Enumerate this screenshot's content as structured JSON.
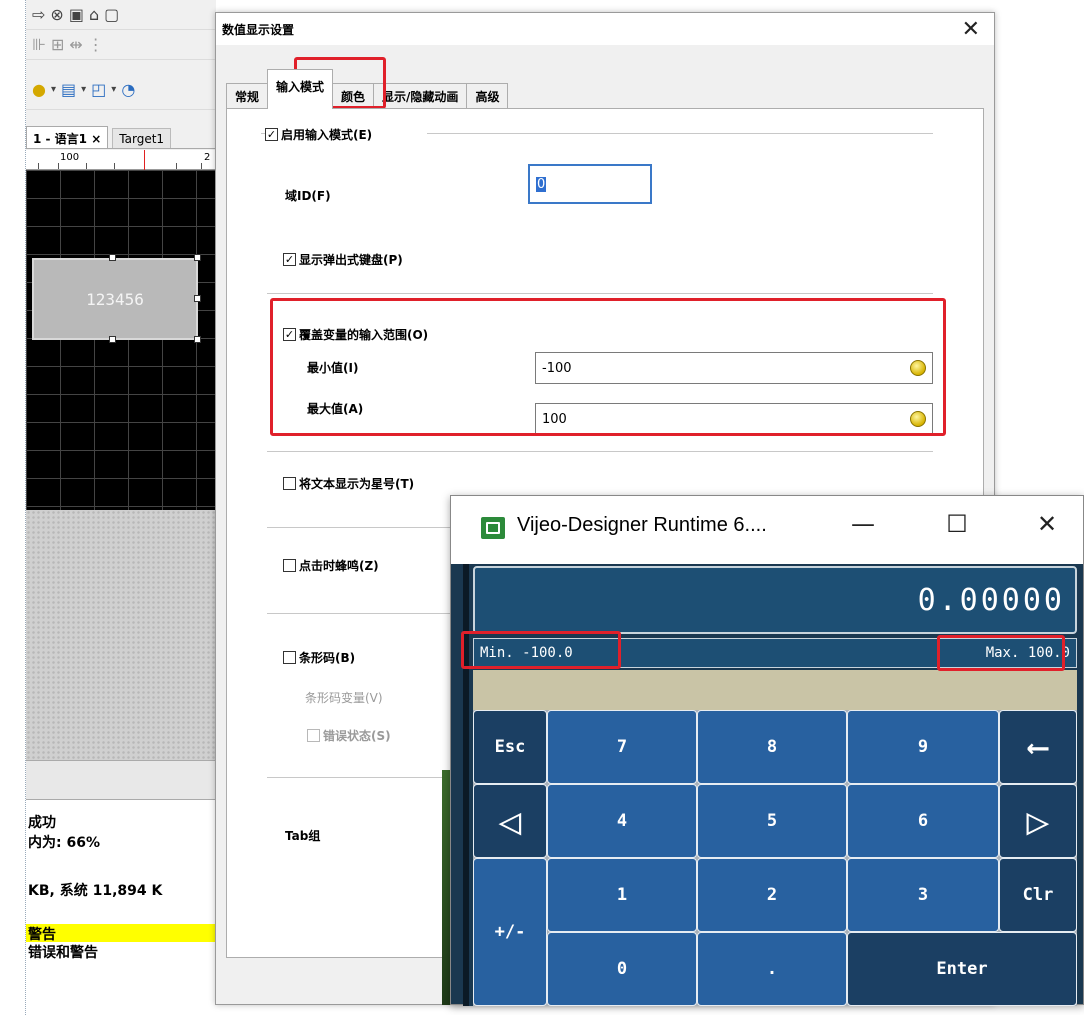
{
  "designer": {
    "tabs": [
      "1 - 语言1  ×",
      "Target1"
    ],
    "ruler_label": "100",
    "ruler_label2": "2",
    "widget_value": "123456",
    "log_lines": [
      "成功",
      "内为:  66%",
      " KB,  系统 11,894 K",
      "警告",
      "错误和警告"
    ]
  },
  "dialog": {
    "title": "数值显示设置",
    "tabs": [
      "常规",
      "输入模式",
      "颜色",
      "显示/隐藏动画",
      "高级"
    ],
    "enable_input": "启用输入模式(E)",
    "field_id_label": "域ID(F)",
    "field_id_value": "0",
    "popup_keyboard": "显示弹出式键盘(P)",
    "override_range": "覆盖变量的输入范围(O)",
    "min_label": "最小值(I)",
    "min_value": "-100",
    "max_label": "最大值(A)",
    "max_value": "100",
    "asterisk": "将文本显示为星号(T)",
    "beep": "点击时蜂鸣(Z)",
    "barcode": "条形码(B)",
    "barcode_var": "条形码变量(V)",
    "error_state": "错误状态(S)",
    "tab_group": "Tab组"
  },
  "runtime": {
    "title": "Vijeo-Designer Runtime 6....",
    "display_value": "0.00000",
    "min_text": "Min. -100.0",
    "max_text": "Max. 100.0",
    "keys": {
      "esc": "Esc",
      "k7": "7",
      "k8": "8",
      "k9": "9",
      "back": "⟵",
      "left": "◁",
      "k4": "4",
      "k5": "5",
      "k6": "6",
      "right": "▷",
      "k1": "1",
      "k2": "2",
      "k3": "3",
      "clr": "Clr",
      "pm": "+/-",
      "k0": "0",
      "dot": ".",
      "enter": "Enter"
    }
  },
  "colors": {
    "highlight_red": "#e0202a",
    "runtime_blue": "#2861a0",
    "runtime_display": "#1d4f74"
  }
}
